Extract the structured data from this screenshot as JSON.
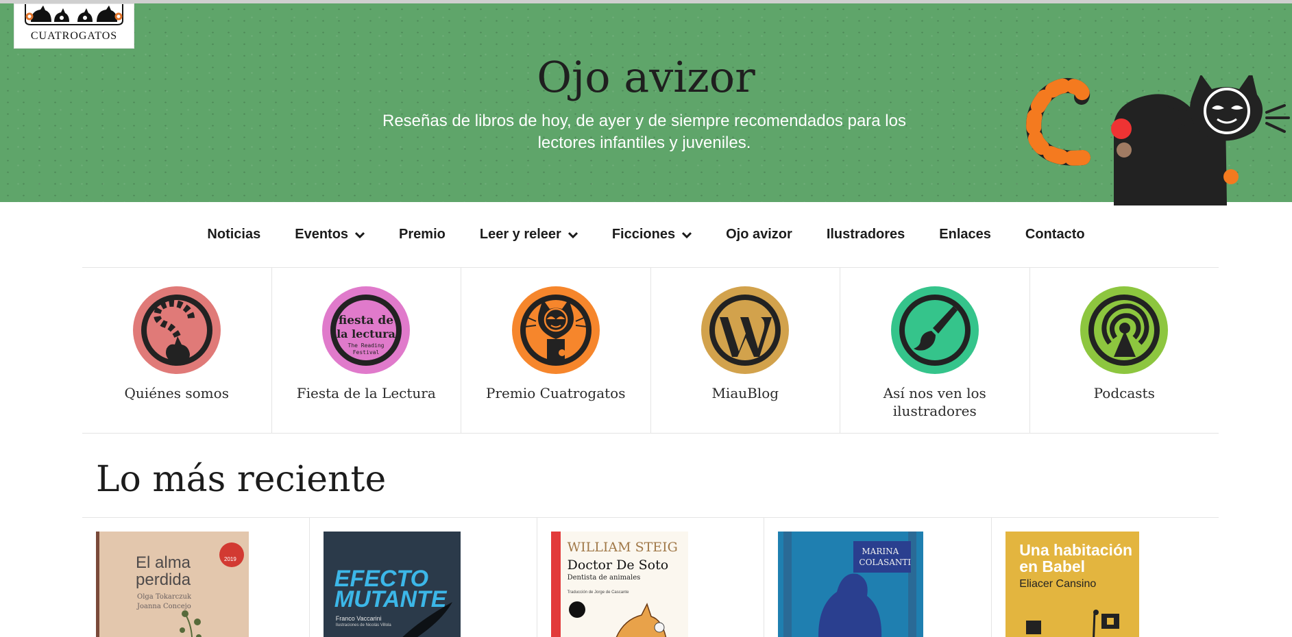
{
  "site": {
    "logo_text": "CUATROGATOS",
    "hero_title": "Ojo avizor",
    "hero_subtitle": "Reseñas de libros de hoy, de ayer y de siempre recomendados para los lectores infantiles y juveniles."
  },
  "nav": {
    "items": [
      {
        "label": "Noticias"
      },
      {
        "label": "Eventos"
      },
      {
        "label": "Premio"
      },
      {
        "label": "Leer y releer"
      },
      {
        "label": "Ficciones"
      },
      {
        "label": "Ojo avizor"
      },
      {
        "label": "Ilustradores"
      },
      {
        "label": "Enlaces"
      },
      {
        "label": "Contacto"
      }
    ]
  },
  "shortcuts": [
    {
      "label": "Quiénes somos",
      "icon": "cat-tail-icon",
      "color": "#e07a78"
    },
    {
      "label": "Fiesta de la Lectura",
      "icon": "fiesta-lectura-icon",
      "color": "#e07acb",
      "icon_text": [
        "fiesta de",
        "la lectura",
        "The Reading",
        "Festival"
      ]
    },
    {
      "label": "Premio Cuatrogatos",
      "icon": "cat-face-icon",
      "color": "#f6862c"
    },
    {
      "label": "MiauBlog",
      "icon": "wordpress-icon",
      "color": "#d2a24c"
    },
    {
      "label": "Así nos ven los ilustradores",
      "icon": "paintbrush-icon",
      "color": "#35c48b"
    },
    {
      "label": "Podcasts",
      "icon": "podcast-icon",
      "color": "#8dc63f"
    }
  ],
  "recent": {
    "title": "Lo más reciente",
    "books": [
      {
        "title_line1": "El alma",
        "title_line2": "perdida",
        "authors_line1": "Olga Tokarczuk",
        "authors_line2": "Joanna Concejo",
        "badge": "2019"
      },
      {
        "title_line1": "EFECTO",
        "title_line2": "MUTANTE",
        "author": "Franco Vaccarini",
        "illustrator": "Ilustraciones de Nicolás Villola"
      },
      {
        "author": "WILLIAM STEIG",
        "title": "Doctor De Soto",
        "subtitle": "Dentista de animales",
        "translator": "Traducción de Jorge de Cascante"
      },
      {
        "author_line1": "MARINA",
        "author_line2": "COLASANTI"
      },
      {
        "title_line1": "Una habitación",
        "title_line2": "en Babel",
        "author": "Eliacer Cansino"
      }
    ]
  }
}
